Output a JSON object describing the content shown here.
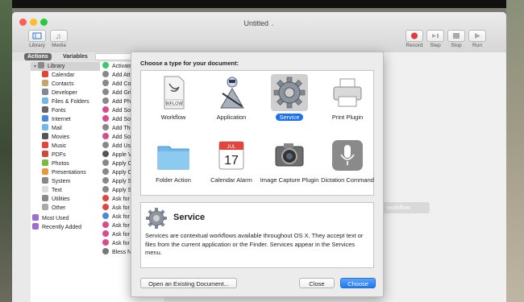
{
  "window": {
    "title": "Untitled"
  },
  "toolbar": {
    "left": [
      {
        "label": "Library",
        "icon": "library-icon"
      },
      {
        "label": "Media",
        "icon": "media-icon"
      }
    ],
    "right": [
      {
        "label": "Record",
        "icon": "record-icon"
      },
      {
        "label": "Step",
        "icon": "step-icon"
      },
      {
        "label": "Stop",
        "icon": "stop-icon"
      },
      {
        "label": "Run",
        "icon": "run-icon"
      }
    ]
  },
  "tabs": {
    "actions": "Actions",
    "variables": "Variables"
  },
  "library": {
    "header": "Library",
    "items": [
      "Calendar",
      "Contacts",
      "Developer",
      "Files & Folders",
      "Fonts",
      "Internet",
      "Mail",
      "Movies",
      "Music",
      "PDFs",
      "Photos",
      "Presentations",
      "System",
      "Text",
      "Utilities",
      "Other"
    ],
    "footer": [
      "Most Used",
      "Recently Added"
    ]
  },
  "actions_list": [
    "Activate",
    "Add Att",
    "Add Col",
    "Add Gri",
    "Add Pho",
    "Add Son",
    "Add Son",
    "Add The",
    "Add Son",
    "Add Use",
    "Apple V",
    "Apply C",
    "Apply C",
    "Apply S",
    "Apply S",
    "Ask for",
    "Ask for",
    "Ask for",
    "Ask for",
    "Ask for",
    "Ask for",
    "Bless NetBoot Image Folder"
  ],
  "workspace": {
    "hint": "r workflow."
  },
  "sheet": {
    "title": "Choose a type for your document:",
    "types": [
      {
        "name": "Workflow",
        "icon": "workflow-document-icon"
      },
      {
        "name": "Application",
        "icon": "automator-robot-icon"
      },
      {
        "name": "Service",
        "icon": "gear-icon",
        "selected": true
      },
      {
        "name": "Print Plugin",
        "icon": "printer-icon"
      },
      {
        "name": "Folder Action",
        "icon": "folder-icon"
      },
      {
        "name": "Calendar Alarm",
        "icon": "calendar-icon"
      },
      {
        "name": "Image Capture Plugin",
        "icon": "camera-icon"
      },
      {
        "name": "Dictation Command",
        "icon": "microphone-icon"
      }
    ],
    "wflow_label": "WFLOW",
    "cal_month": "JUL",
    "cal_day": "17",
    "description": {
      "title": "Service",
      "text": "Services are contextual workflows available throughout OS X. They accept text or files from the current application or the Finder. Services appear in the Services menu."
    },
    "buttons": {
      "open": "Open an Existing Document...",
      "close": "Close",
      "choose": "Choose"
    }
  },
  "colors": {
    "accent": "#1a6ef5",
    "record": "#e0393e"
  }
}
